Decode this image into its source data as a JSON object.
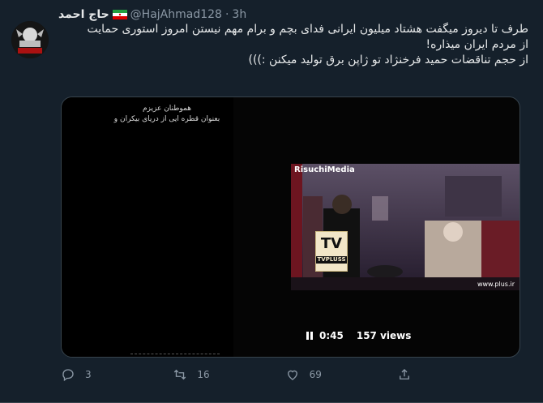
{
  "tweet": {
    "display_name": "حاج احمد",
    "handle": "@HajAhmad128",
    "separator": "·",
    "time": "3h",
    "text_lines": [
      "طرف تا دیروز میگفت هشتاد میلیون ایرانی فدای بچم و برام مهم نیستن  امروز استوری حمایت",
      "از مردم ایران میذاره!",
      "از حجم تناقضات حمید فرخنژاد تو ژاپن برق تولید میکنن :)))"
    ]
  },
  "video": {
    "intro_lines": [
      "هموطنان عزیزم",
      "بعنوان قطره ایی از دریای بیکران و"
    ],
    "watermark": "RisuchiMedia",
    "site_watermark": "www.plus.ir",
    "tv_logo_text": "TV",
    "tv_logo_subtext": "TVPLUSS",
    "time": "0:45",
    "views": "157 views"
  },
  "actions": {
    "reply_count": "3",
    "retweet_count": "16",
    "like_count": "69",
    "share_count": ""
  }
}
